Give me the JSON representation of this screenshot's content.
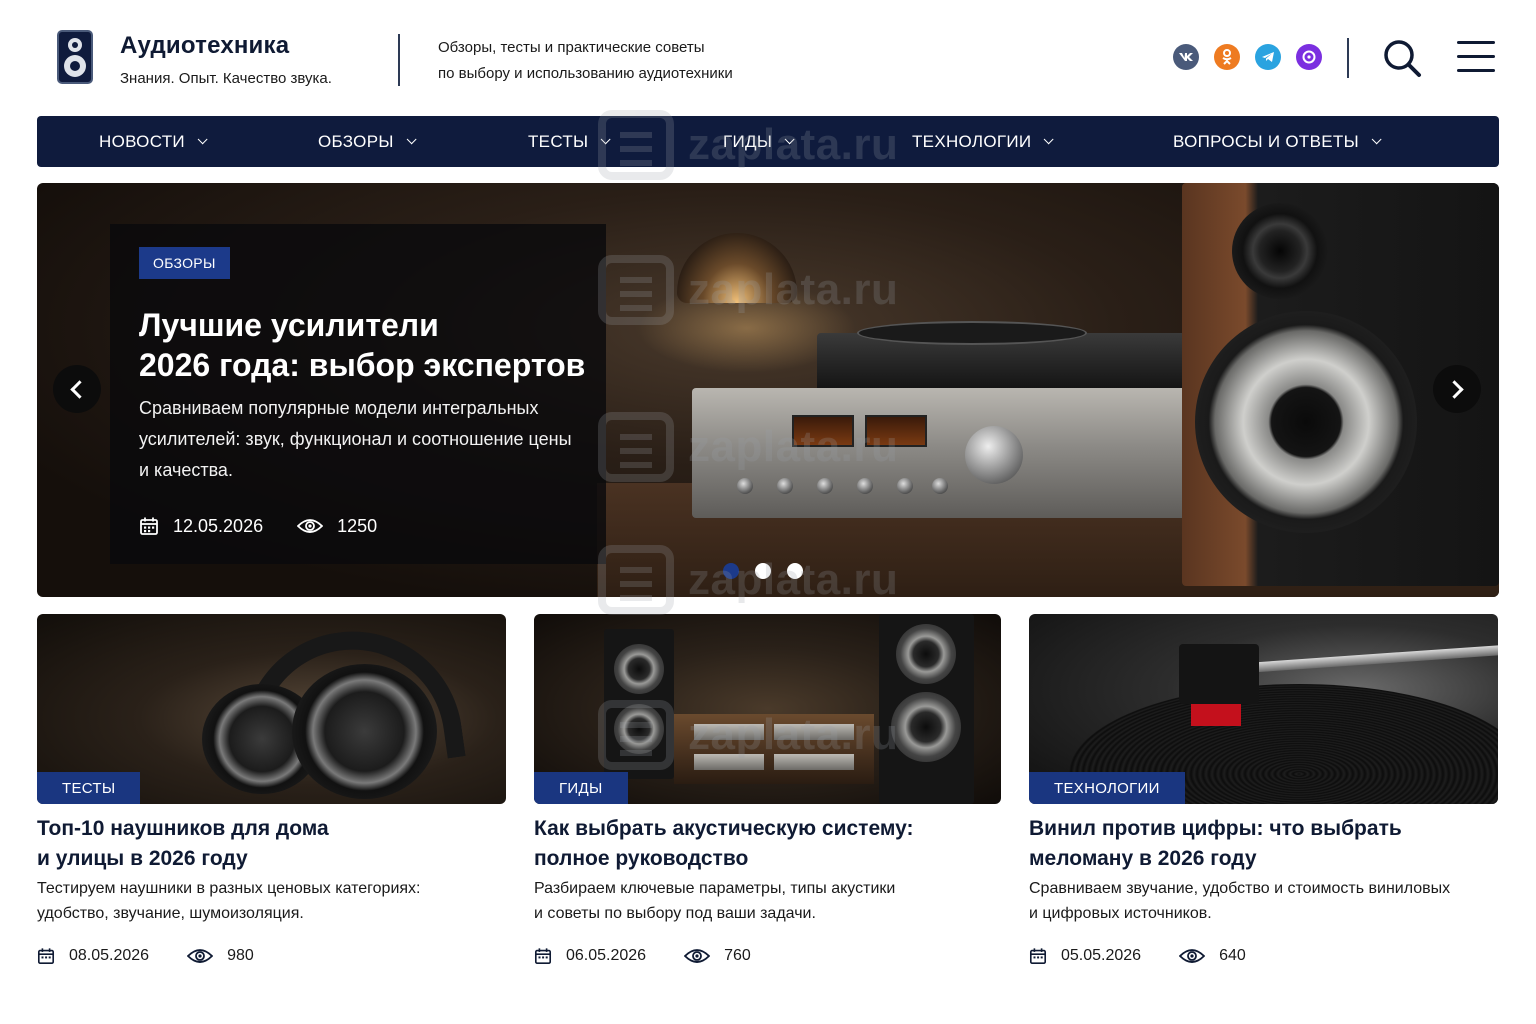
{
  "header": {
    "brand_name": "Аудиотехника",
    "brand_slogan": "Знания. Опыт. Качество звука.",
    "tagline_line1": "Обзоры, тесты и практические советы",
    "tagline_line2": "по выбору и использованию аудиотехники",
    "social": [
      {
        "name": "vk-icon",
        "label": "VK",
        "color": "#4a5a7a"
      },
      {
        "name": "odnoklassniki-icon",
        "label": "OK",
        "color": "#ee7b21"
      },
      {
        "name": "telegram-icon",
        "label": "TG",
        "color": "#2aa3e0"
      },
      {
        "name": "max-icon",
        "label": "MAX",
        "color": "#7b2fe0"
      }
    ]
  },
  "nav": {
    "items": [
      "НОВОСТИ",
      "ОБЗОРЫ",
      "ТЕСТЫ",
      "ГИДЫ",
      "ТЕХНОЛОГИИ",
      "ВОПРОСЫ И ОТВЕТЫ"
    ]
  },
  "hero": {
    "badge": "ОБЗОРЫ",
    "title_line1": "Лучшие усилители",
    "title_line2": "2026 года: выбор экспертов",
    "description": "Сравниваем популярные модели интегральных усилителей: звук, функционал и соотношение цены и качества.",
    "date": "12.05.2026",
    "views": "1250",
    "slides_total": 3,
    "active_slide": 1
  },
  "cards": [
    {
      "badge": "ТЕСТЫ",
      "title_line1": "Топ-10 наушников для дома",
      "title_line2": "и улицы в 2026 году",
      "desc_line1": "Тестируем наушники в разных ценовых категориях:",
      "desc_line2": "удобство, звучание, шумоизоляция.",
      "date": "08.05.2026",
      "views": "980"
    },
    {
      "badge": "ГИДЫ",
      "title_line1": "Как выбрать акустическую систему:",
      "title_line2": "полное руководство",
      "desc_line1": "Разбираем ключевые параметры, типы акустики",
      "desc_line2": "и советы по выбору под ваши задачи.",
      "date": "06.05.2026",
      "views": "760"
    },
    {
      "badge": "ТЕХНОЛОГИИ",
      "title_line1": "Винил против цифры: что выбрать",
      "title_line2": "меломану в 2026 году",
      "desc_line1": "Сравниваем звучание, удобство и стоимость виниловых",
      "desc_line2": "и цифровых источников.",
      "date": "05.05.2026",
      "views": "640"
    }
  ],
  "watermark": "zaplata.ru",
  "colors": {
    "nav_bg": "#0f1b3d",
    "badge_blue": "#1c3a8a",
    "text_dark": "#0f1a33"
  }
}
